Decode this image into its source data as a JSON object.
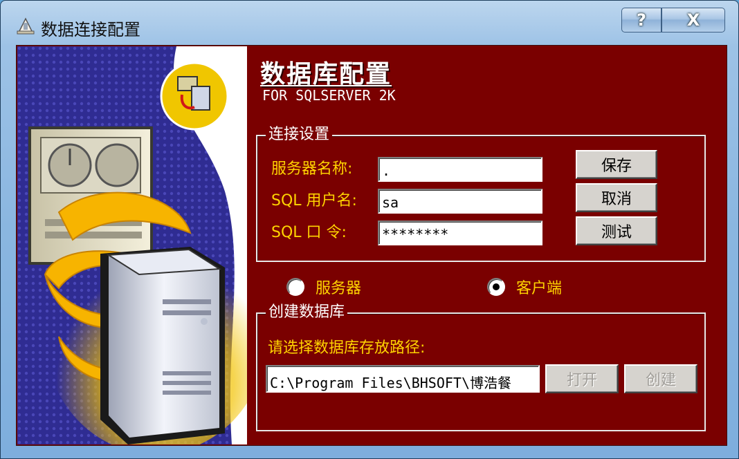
{
  "window": {
    "title": "数据连接配置",
    "help_glyph": "?",
    "close_glyph": "X"
  },
  "header": {
    "title": "数据库配置",
    "subtitle": "FOR SQLSERVER 2K"
  },
  "connection": {
    "legend": "连接设置",
    "server_label": "服务器名称:",
    "server_value": ".",
    "user_label": "SQL 用户名:",
    "user_value": "sa",
    "password_label": "SQL 口 令:",
    "password_value": "********",
    "save_label": "保存",
    "cancel_label": "取消",
    "test_label": "测试"
  },
  "mode": {
    "options": [
      {
        "label": "服务器",
        "checked": false
      },
      {
        "label": "客户端",
        "checked": true
      }
    ]
  },
  "create_db": {
    "legend": "创建数据库",
    "path_label": "请选择数据库存放路径:",
    "path_value": "C:\\Program Files\\BHSOFT\\博浩餐",
    "open_label": "打开",
    "create_label": "创建"
  },
  "colors": {
    "panel_bg": "#7a0000",
    "label_text": "#ffd400",
    "art_bg": "#2f2c92"
  }
}
